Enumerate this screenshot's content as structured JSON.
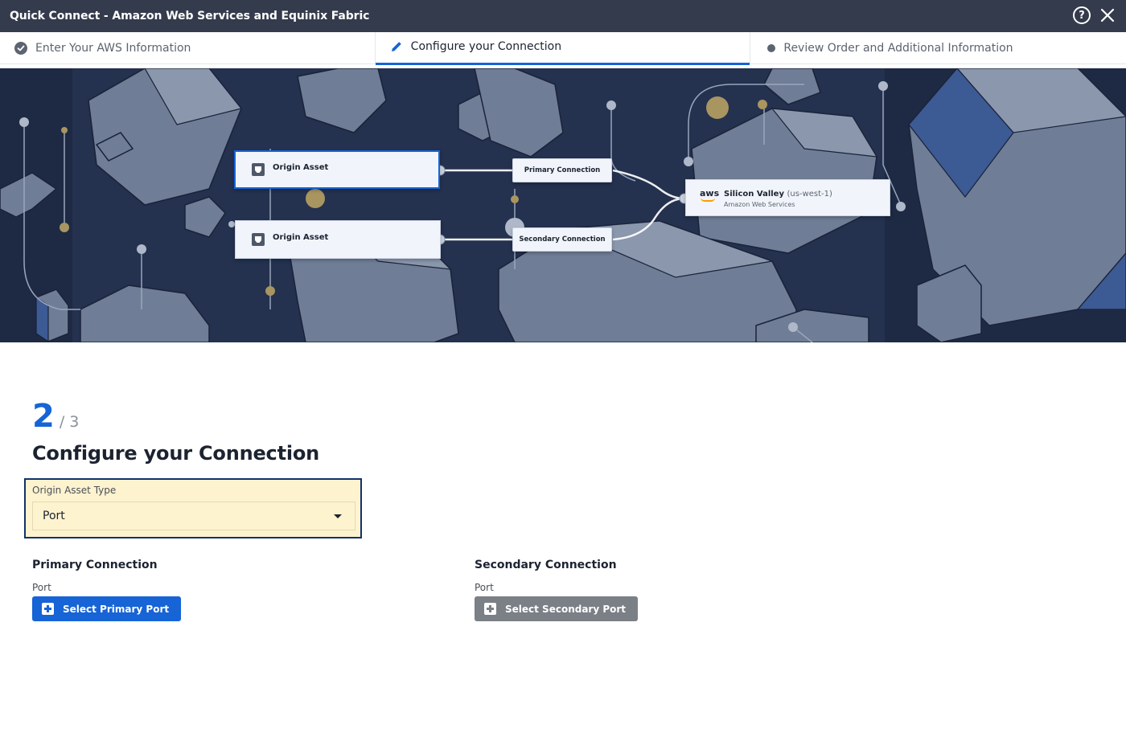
{
  "window": {
    "title": "Quick Connect - Amazon Web Services and Equinix Fabric",
    "help_icon": "question-circle-icon",
    "close_icon": "close-icon"
  },
  "stepper": {
    "steps": [
      {
        "label": "Enter Your AWS Information",
        "state": "completed",
        "icon": "check-circle-icon"
      },
      {
        "label": "Configure your Connection",
        "state": "active",
        "icon": "pencil-icon"
      },
      {
        "label": "Review Order and Additional Information",
        "state": "pending",
        "icon": "dot-icon"
      }
    ]
  },
  "diagram": {
    "origin_primary": "Origin Asset",
    "origin_secondary": "Origin Asset",
    "primary_connection": "Primary Connection",
    "secondary_connection": "Secondary Connection",
    "destination": {
      "logo": "aws",
      "name": "Silicon Valley",
      "region": "(us-west-1)",
      "provider": "Amazon Web Services"
    }
  },
  "form": {
    "step_current": "2",
    "step_total": "/ 3",
    "title": "Configure your Connection",
    "origin_asset_type": {
      "label": "Origin Asset Type",
      "value": "Port"
    },
    "primary": {
      "title": "Primary Connection",
      "port_label": "Port",
      "button": "Select Primary Port"
    },
    "secondary": {
      "title": "Secondary Connection",
      "port_label": "Port",
      "button": "Select Secondary Port"
    }
  },
  "colors": {
    "titlebar": "#343b4c",
    "accent": "#1664d6",
    "banner": "#1e2a44",
    "highlight": "#fdf3cf",
    "disabled": "#7b7f86"
  }
}
